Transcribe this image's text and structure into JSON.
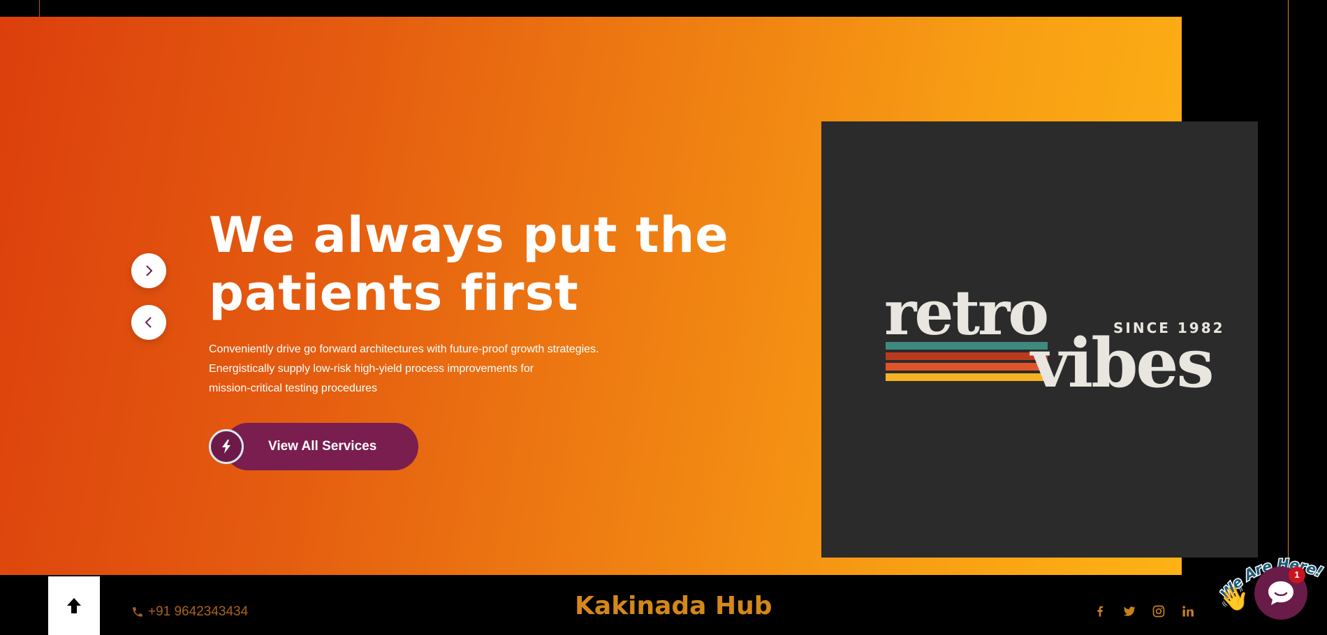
{
  "hero": {
    "headline_line1": "We always put the",
    "headline_line2": "patients first",
    "description_line1": "Conveniently drive go forward architectures with future-proof growth strategies.",
    "description_line2": "Energistically supply low-risk high-yield process improvements for",
    "description_line3": "mission-critical testing procedures",
    "cta_label": "View All Services",
    "cta_icon": "bolt-icon",
    "next_icon": "chevron-right-icon",
    "prev_icon": "chevron-left-icon"
  },
  "logo": {
    "word1": "retro",
    "word2": "vibes",
    "tagline": "SINCE 1982",
    "stripe_colors": [
      "#3e8a7e",
      "#b93a1f",
      "#e0542a",
      "#f4b223"
    ]
  },
  "footer": {
    "phone": "+91 9642343434",
    "brand": "Kakinada Hub",
    "socials": [
      "facebook-icon",
      "twitter-icon",
      "instagram-icon",
      "linkedin-icon"
    ],
    "scroll_top_icon": "arrow-up-icon"
  },
  "chat": {
    "greeting": "We Are Here!",
    "badge_count": "1",
    "wave_emoji": "👋"
  },
  "colors": {
    "gradient_start": "#dc3f0c",
    "gradient_end": "#fdb215",
    "cta_bg": "#7a1d4f",
    "footer_accent": "#d4871a"
  }
}
